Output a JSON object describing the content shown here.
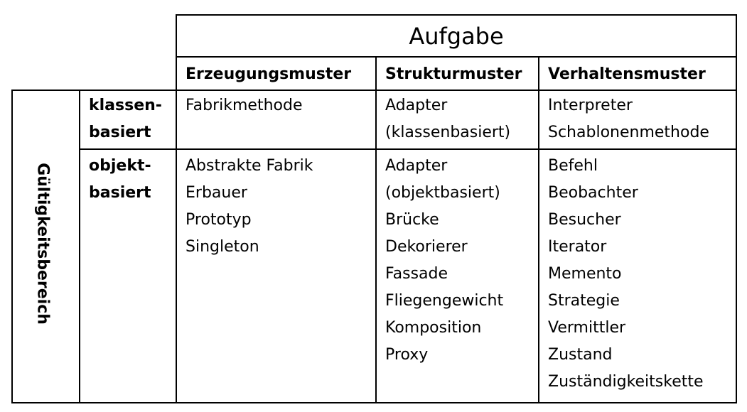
{
  "table": {
    "title": "Aufgabe",
    "side_label": "Gültigkeitsbereich",
    "columns": [
      "Erzeugungsmuster",
      "Strukturmuster",
      "Verhaltensmuster"
    ],
    "rows": [
      {
        "label": [
          "klassen-",
          "basiert"
        ],
        "cells": [
          [
            "Fabrikmethode"
          ],
          [
            "Adapter",
            "(klassenbasiert)"
          ],
          [
            "Interpreter",
            "Schablonenmethode"
          ]
        ]
      },
      {
        "label": [
          "objekt-",
          "basiert"
        ],
        "cells": [
          [
            "Abstrakte Fabrik",
            "Erbauer",
            "Prototyp",
            "Singleton"
          ],
          [
            "Adapter",
            "(objektbasiert)",
            "Brücke",
            "Dekorierer",
            "Fassade",
            "Fliegengewicht",
            "Komposition",
            "Proxy"
          ],
          [
            "Befehl",
            "Beobachter",
            "Besucher",
            "Iterator",
            "Memento",
            "Strategie",
            "Vermittler",
            "Zustand",
            "Zuständigkeitskette"
          ]
        ]
      }
    ]
  }
}
